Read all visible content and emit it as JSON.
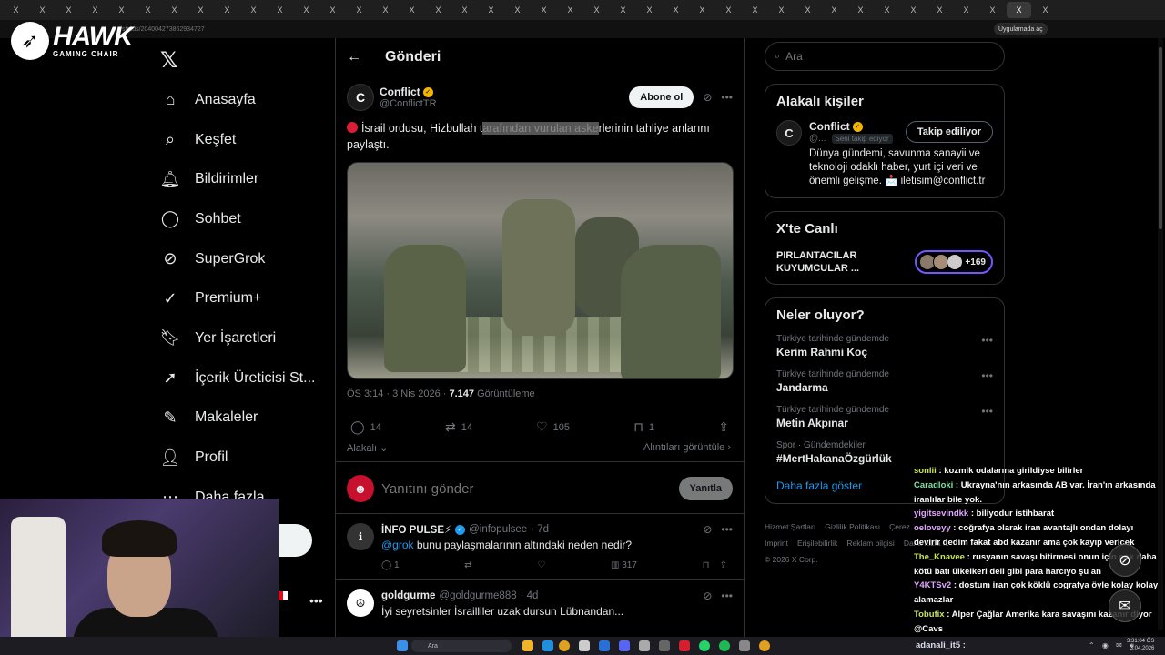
{
  "browser": {
    "tab_count": 40,
    "tab_glyph": "X",
    "url": "/status/2040042738629347 27",
    "url_clean": "/status/2040042738629​34727",
    "app_chip": "Uygulamada aç"
  },
  "brand": {
    "name": "HAWK",
    "sub": "GAMING CHAIR"
  },
  "nav": {
    "items": [
      {
        "label": "Anasayfa",
        "icon": "home-icon"
      },
      {
        "label": "Keşfet",
        "icon": "search-icon"
      },
      {
        "label": "Bildirimler",
        "icon": "bell-icon"
      },
      {
        "label": "Sohbet",
        "icon": "chat-icon"
      },
      {
        "label": "SuperGrok",
        "icon": "grok-icon"
      },
      {
        "label": "Premium+",
        "icon": "verified-icon"
      },
      {
        "label": "Yer İşaretleri",
        "icon": "bookmark-icon"
      },
      {
        "label": "İçerik Üreticisi St...",
        "icon": "rocket-icon"
      },
      {
        "label": "Makaleler",
        "icon": "article-icon"
      },
      {
        "label": "Profil",
        "icon": "person-icon"
      },
      {
        "label": "Daha fazla",
        "icon": "more-icon"
      }
    ]
  },
  "main": {
    "title": "Gönderi",
    "post": {
      "author_name": "Conflict",
      "author_handle": "@ConflictTR",
      "subscribe_label": "Abone ol",
      "text_before": "İsrail ordusu, Hizbullah t",
      "text_highlight": "arafından vurulan aske",
      "text_after": "rlerinin tahliye anlarını paylaştı.",
      "meta_time": "ÖS 3:14 · 3 Nis 2026 · ",
      "views": "7.147",
      "views_label": " Görüntüleme",
      "stats": {
        "replies": "14",
        "reposts": "14",
        "likes": "105",
        "bookmarks": "1"
      },
      "related_label": "Alakalı",
      "quotes_label": "Alıntıları görüntüle"
    },
    "reply": {
      "placeholder": "Yanıtını gönder",
      "button_label": "Yanıtla"
    },
    "replies": [
      {
        "name": "İNFO PULSE⚡",
        "handle": "@infopulsee",
        "time": "· 7d",
        "mention": "@grok",
        "text": " bunu paylaşmalarının altındaki neden nedir?",
        "replies": "1",
        "views": "317"
      },
      {
        "name": "goldgurme",
        "handle": "@goldgurme888",
        "time": "· 4d",
        "text": "İyi seyretsinler İsrailliler uzak dursun Lübnandan..."
      }
    ]
  },
  "right": {
    "search_placeholder": "Ara",
    "related_people": {
      "title": "Alakalı kişiler",
      "name": "Conflict",
      "handle": "@...",
      "follows_you": "Seni takip ediyor",
      "follow_label": "Takip ediliyor",
      "bio": "Dünya gündemi, savunma sanayii ve teknoloji odaklı haber, yurt içi veri ve önemli gelişme. 📩 iletisim@conflict.tr"
    },
    "live": {
      "title": "X'te Canlı",
      "text": "PIRLANTACILAR KUYUMCULAR ...",
      "count": "+169"
    },
    "trends": {
      "title": "Neler oluyor?",
      "items": [
        {
          "meta": "Türkiye tarihinde gündemde",
          "name": "Kerim Rahmi Koç"
        },
        {
          "meta": "Türkiye tarihinde gündemde",
          "name": "Jandarma"
        },
        {
          "meta": "Türkiye tarihinde gündemde",
          "name": "Metin Akpınar"
        },
        {
          "meta": "Spor · Gündemdekiler",
          "name": "#MertHakanaÖzgürlük"
        }
      ],
      "show_more": "Daha fazla göster"
    },
    "footer": {
      "links": [
        "Hizmet Şartları",
        "Gizlilik Politikası",
        "Çerez",
        "Imprint",
        "Erişilebilirlik",
        "Reklam bilgisi",
        "Daha fazla ..."
      ],
      "copyright": "© 2026 X Corp."
    }
  },
  "chat": [
    {
      "user": "sonlii",
      "msg": " : kozmik odalarına girildiyse bilirler"
    },
    {
      "user": "Caradloki",
      "msg": " : Ukrayna'nın arkasında AB var. İran'ın arkasında iranlılar bile yok."
    },
    {
      "user": "yigitsevindkk",
      "msg": " : biliyodur istihbarat"
    },
    {
      "user": "oeloveyy",
      "msg": " : coğrafya olarak iran avantajlı ondan dolayı devirir dedim fakat abd kazanır ama çok kayıp vericek"
    },
    {
      "user": "The_Knavee",
      "msg": " : rusyanın savaşı bitirmesi onun için çok daha kötü batı ülkelkeri deli gibi para harcıyo şu an"
    },
    {
      "user": "Y4KTSv2",
      "msg": " : dostum iran çok köklü cografya öyle kolay kolay alamazlar"
    },
    {
      "user": "Tobufix",
      "msg": " : Alper Çağlar Amerika kara savaşını kazanır diyor @Cavs"
    },
    {
      "user": "adanali_it5",
      "msg": " :"
    }
  ],
  "taskbar": {
    "search_label": "Ara",
    "time": "3:31:04 ÖS",
    "date": "3.04.2026"
  },
  "colors": {
    "accent": "#1d9bf0",
    "background": "#000000",
    "border": "#2f3336",
    "muted": "#71767b",
    "live_border": "#7856ff"
  }
}
